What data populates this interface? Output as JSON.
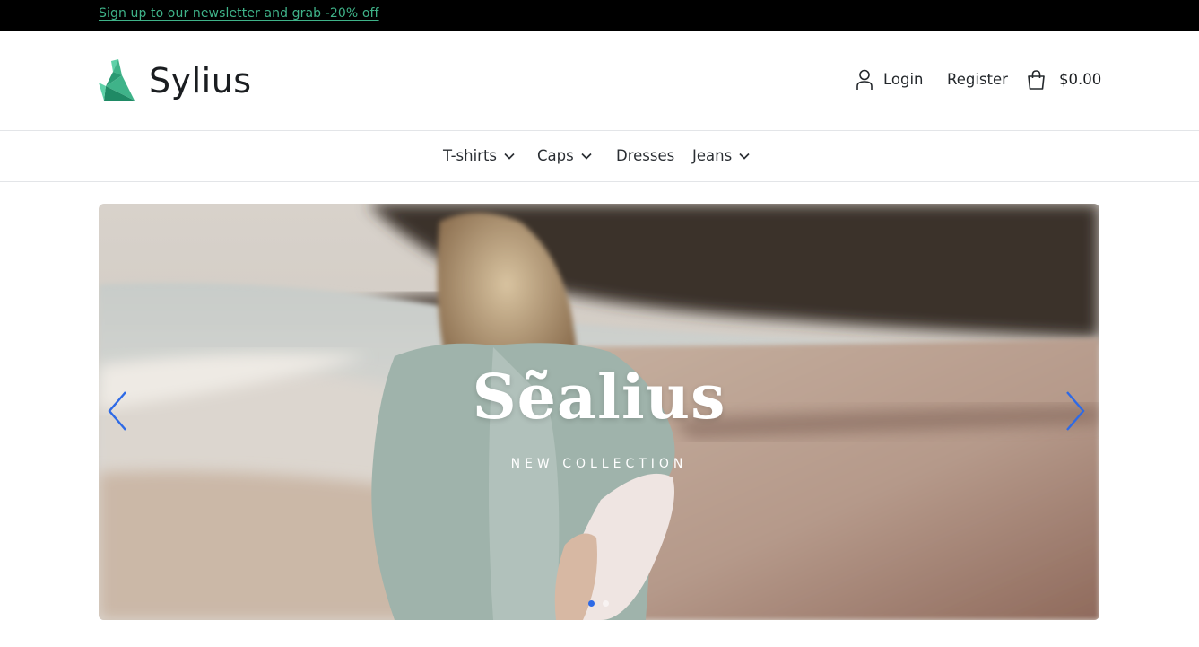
{
  "topbar": {
    "newsletter_text": "Sign up to our newsletter and grab -20% off"
  },
  "header": {
    "brand_name": "Sylius",
    "login_label": "Login",
    "register_label": "Register",
    "cart_total": "$0.00"
  },
  "nav": {
    "items": [
      {
        "label": "T-shirts",
        "has_dropdown": true
      },
      {
        "label": "Caps",
        "has_dropdown": true
      },
      {
        "label": "Dresses",
        "has_dropdown": false
      },
      {
        "label": "Jeans",
        "has_dropdown": true
      }
    ]
  },
  "hero": {
    "title": "Sẽalius",
    "subtitle": "NEW COLLECTION",
    "slide_count": 2,
    "active_slide": 1
  },
  "colors": {
    "topbar_bg": "#000000",
    "brand_accent": "#3fb389",
    "arrow_color": "#2e6ae6"
  },
  "icons": [
    "user-icon",
    "shopping-bag-icon",
    "chevron-down-icon",
    "chevron-left-icon",
    "chevron-right-icon"
  ]
}
